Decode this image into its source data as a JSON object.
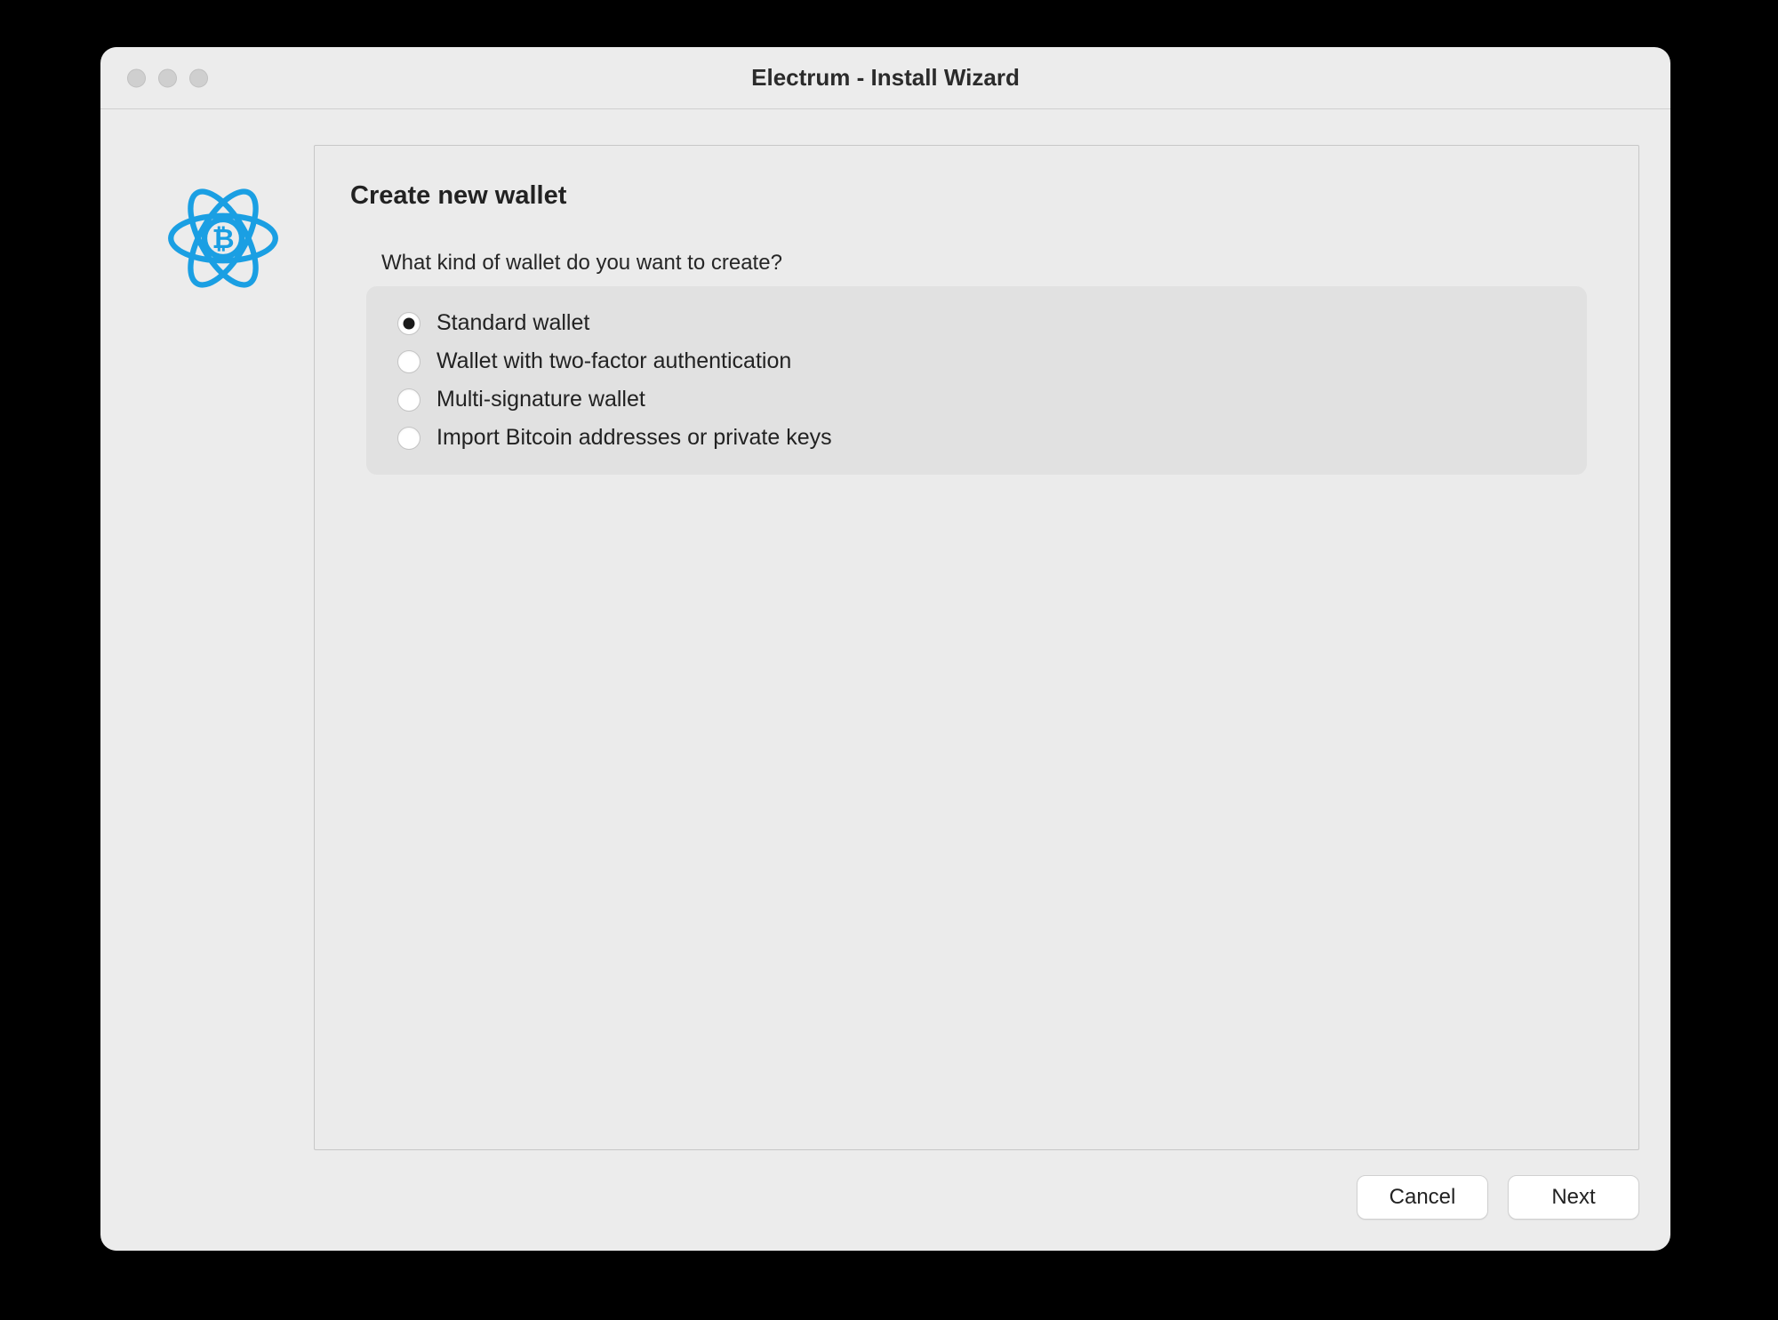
{
  "window": {
    "title": "Electrum  -  Install Wizard"
  },
  "logo": {
    "name": "electrum-logo-icon",
    "color": "#1a9fe3"
  },
  "main": {
    "heading": "Create new wallet",
    "prompt": "What kind of wallet do you want to create?",
    "options": [
      {
        "label": "Standard wallet",
        "selected": true
      },
      {
        "label": "Wallet with two-factor authentication",
        "selected": false
      },
      {
        "label": "Multi-signature wallet",
        "selected": false
      },
      {
        "label": "Import Bitcoin addresses or private keys",
        "selected": false
      }
    ]
  },
  "footer": {
    "cancel_label": "Cancel",
    "next_label": "Next"
  }
}
